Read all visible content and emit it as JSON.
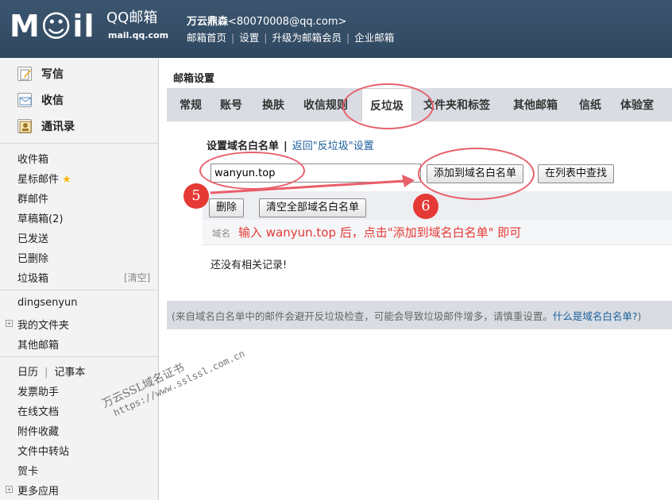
{
  "header": {
    "logo_text": "M☺il",
    "qq_brand": "QQ邮箱",
    "domain": "mail.qq.com",
    "account_name": "万云鼎森",
    "account_email": "<80070008@qq.com>",
    "nav": [
      "邮箱首页",
      "设置",
      "升级为邮箱会员",
      "企业邮箱"
    ]
  },
  "sidebar": {
    "main_actions": [
      {
        "label": "写信",
        "icon": "compose-icon"
      },
      {
        "label": "收信",
        "icon": "inbox-icon"
      },
      {
        "label": "通讯录",
        "icon": "contacts-icon"
      }
    ],
    "folders": [
      "收件箱",
      "星标邮件",
      "群邮件",
      "草稿箱(2)",
      "已发送",
      "已删除",
      "垃圾箱"
    ],
    "trash_clear": "[清空]",
    "user_folder": "dingsenyun",
    "my_folders": "我的文件夹",
    "other_mailboxes": "其他邮箱",
    "calendar": "日历",
    "notes": "记事本",
    "tools": [
      "发票助手",
      "在线文档",
      "附件收藏",
      "文件中转站",
      "贺卡"
    ],
    "more_apps": "更多应用"
  },
  "main": {
    "title": "邮箱设置",
    "tabs": [
      "常规",
      "账号",
      "换肤",
      "收信规则",
      "反垃圾",
      "文件夹和标签",
      "其他邮箱",
      "信纸",
      "体验室"
    ],
    "active_tab": "反垃圾",
    "sub_title": "设置域名白名单",
    "back_link": "返回\"反垃圾\"设置",
    "input_value": "wanyun.top",
    "add_button": "添加到域名白名单",
    "search_button": "在列表中查找",
    "delete_button": "删除",
    "clear_button": "清空全部域名白名单",
    "column_label": "域名",
    "empty_text": "还没有相关记录!",
    "footer_text": "(来自域名白名单中的邮件会避开反垃圾检查，可能会导致垃圾邮件增多，请慎重设置。",
    "footer_link": "什么是域名白名单?",
    "footer_end": ")"
  },
  "annotations": {
    "step5": "5",
    "step6": "6",
    "instruction": "输入 wanyun.top  后，点击\"添加到域名白名单\" 即可",
    "watermark_line1": "万云SSL域名证书",
    "watermark_line2": "https://www.sslssl.com.cn",
    "accent_color": "#e53935"
  }
}
